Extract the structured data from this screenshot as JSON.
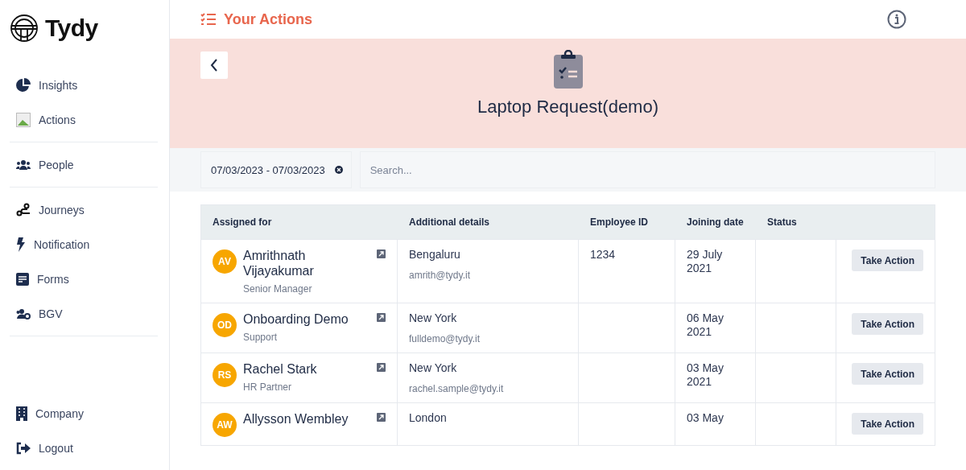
{
  "brand": {
    "name": "Tydy"
  },
  "sidebar": {
    "groups": [
      {
        "items": [
          {
            "label": "Insights"
          },
          {
            "label": "Actions"
          }
        ]
      },
      {
        "items": [
          {
            "label": "People"
          }
        ]
      },
      {
        "items": [
          {
            "label": "Journeys"
          },
          {
            "label": "Notification"
          },
          {
            "label": "Forms"
          },
          {
            "label": "BGV"
          }
        ]
      }
    ],
    "bottom": [
      {
        "label": "Company"
      },
      {
        "label": "Logout"
      }
    ]
  },
  "header": {
    "title": "Your Actions"
  },
  "banner": {
    "title": "Laptop Request(demo)"
  },
  "filters": {
    "date_range": "07/03/2023 - 07/03/2023",
    "search": {
      "placeholder": "Search..."
    }
  },
  "table": {
    "columns": [
      "Assigned for",
      "Additional details",
      "Employee ID",
      "Joining date",
      "Status"
    ],
    "rows": [
      {
        "initials": "AV",
        "name": "Amrithnath Vijayakumar",
        "role": "Senior Manager",
        "location": "Bengaluru",
        "email": "amrith@tydy.it",
        "employee_id": "1234",
        "joining_date": "29 July 2021",
        "action": "Take Action"
      },
      {
        "initials": "OD",
        "name": "Onboarding Demo",
        "role": "Support",
        "location": "New York",
        "email": "fulldemo@tydy.it",
        "joining_date": "06 May 2021",
        "action": "Take Action"
      },
      {
        "initials": "RS",
        "name": "Rachel Stark",
        "role": "HR Partner",
        "location": "New York",
        "email": "rachel.sample@tydy.it",
        "joining_date": "03 May 2021",
        "action": "Take Action"
      },
      {
        "initials": "AW",
        "name": "Allysson Wembley",
        "location": "London",
        "joining_date": "03 May",
        "action": "Take Action"
      }
    ]
  }
}
